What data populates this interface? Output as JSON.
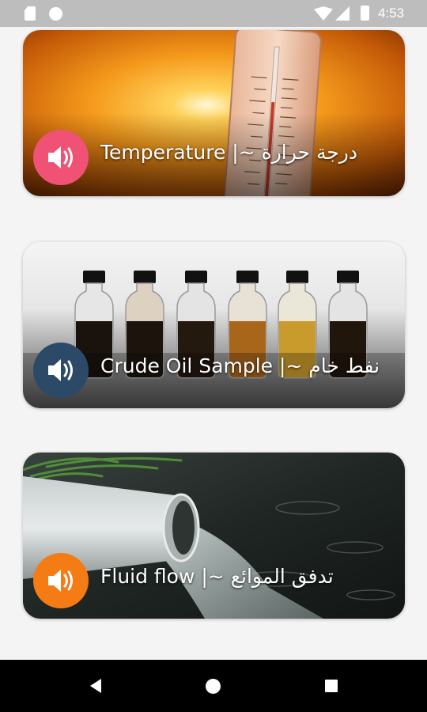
{
  "status_bar": {
    "time": "4:53",
    "icons": [
      "sim-card-icon",
      "circle-notification-icon",
      "wifi-icon",
      "cell-signal-icon",
      "battery-icon"
    ]
  },
  "cards": [
    {
      "title": "Temperature |~ درجة حرارة",
      "button_color": "#ef5274",
      "icon": "speaker-icon"
    },
    {
      "title": "Crude Oil Sample |~ نفط خام",
      "button_color": "#2c4a68",
      "icon": "speaker-icon"
    },
    {
      "title": "Fluid flow |~ تدفق الموائع",
      "button_color": "#f57c14",
      "icon": "speaker-icon"
    }
  ],
  "nav_bar": {
    "icons": [
      "back-icon",
      "home-icon",
      "recents-icon"
    ]
  }
}
